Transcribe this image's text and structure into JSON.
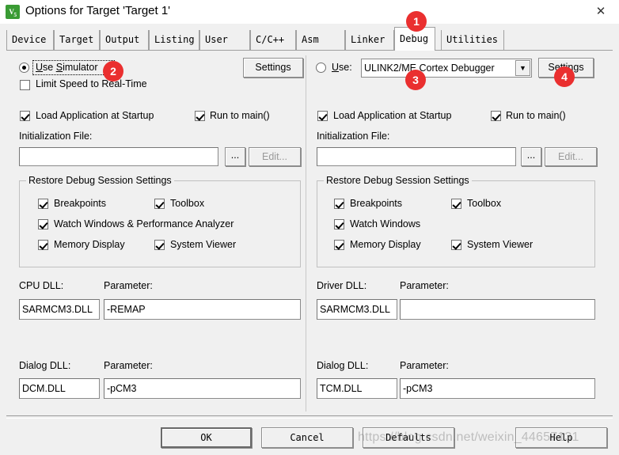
{
  "window": {
    "title": "Options for Target 'Target 1'",
    "icon": "uvision-logo-icon",
    "close_label": "✕"
  },
  "tabs": [
    {
      "label": "Device",
      "selected": false
    },
    {
      "label": "Target",
      "selected": false
    },
    {
      "label": "Output",
      "selected": false
    },
    {
      "label": "Listing",
      "selected": false
    },
    {
      "label": "User",
      "selected": false
    },
    {
      "label": "C/C++",
      "selected": false
    },
    {
      "label": "Asm",
      "selected": false
    },
    {
      "label": "Linker",
      "selected": false
    },
    {
      "label": "Debug",
      "selected": true
    },
    {
      "label": "Utilities",
      "selected": false
    }
  ],
  "left": {
    "use_simulator_label": "Use Simulator",
    "use_simulator_checked": true,
    "limit_speed_label": "Limit Speed to Real-Time",
    "limit_speed_checked": false,
    "settings_label": "Settings",
    "load_app_label": "Load Application at Startup",
    "load_app_checked": true,
    "run_to_main_label": "Run to main()",
    "run_to_main_checked": true,
    "init_file_label": "Initialization File:",
    "init_file_value": "",
    "browse_label": "...",
    "edit_label": "Edit...",
    "edit_disabled": true,
    "restore_group_title": "Restore Debug Session Settings",
    "restore": [
      {
        "label": "Breakpoints",
        "checked": true
      },
      {
        "label": "Toolbox",
        "checked": true
      },
      {
        "label": "Watch Windows & Performance Analyzer",
        "checked": true
      },
      {
        "label": "Memory Display",
        "checked": true
      },
      {
        "label": "System Viewer",
        "checked": true
      }
    ],
    "cpu_dll_label": "CPU DLL:",
    "cpu_dll_value": "SARMCM3.DLL",
    "cpu_param_label": "Parameter:",
    "cpu_param_value": "-REMAP",
    "dialog_dll_label": "Dialog DLL:",
    "dialog_dll_value": "DCM.DLL",
    "dialog_param_label": "Parameter:",
    "dialog_param_value": "-pCM3"
  },
  "right": {
    "use_label": "Use:",
    "use_checked": false,
    "debugger_value": "ULINK2/ME Cortex Debugger",
    "combo_arrow": "▼",
    "settings_label": "Settings",
    "load_app_label": "Load Application at Startup",
    "load_app_checked": true,
    "run_to_main_label": "Run to main()",
    "run_to_main_checked": true,
    "init_file_label": "Initialization File:",
    "init_file_value": "",
    "browse_label": "...",
    "edit_label": "Edit...",
    "edit_disabled": true,
    "restore_group_title": "Restore Debug Session Settings",
    "restore": [
      {
        "label": "Breakpoints",
        "checked": true
      },
      {
        "label": "Toolbox",
        "checked": true
      },
      {
        "label": "Watch Windows",
        "checked": true
      },
      {
        "label": "Memory Display",
        "checked": true
      },
      {
        "label": "System Viewer",
        "checked": true
      }
    ],
    "driver_dll_label": "Driver DLL:",
    "driver_dll_value": "SARMCM3.DLL",
    "driver_param_label": "Parameter:",
    "driver_param_value": "",
    "dialog_dll_label": "Dialog DLL:",
    "dialog_dll_value": "TCM.DLL",
    "dialog_param_label": "Parameter:",
    "dialog_param_value": "-pCM3"
  },
  "footer": {
    "ok_label": "OK",
    "cancel_label": "Cancel",
    "defaults_label": "Defaults",
    "help_label": "Help"
  },
  "annotations": [
    {
      "number": "1"
    },
    {
      "number": "2"
    },
    {
      "number": "3"
    },
    {
      "number": "4"
    }
  ],
  "watermark": {
    "text": "https://blog.csdn.net/weixin_44657131"
  }
}
